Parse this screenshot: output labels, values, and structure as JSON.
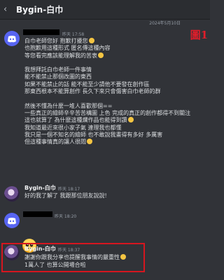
{
  "header": {
    "title": "Bygin-白巾",
    "back_icon": "chevron-left-icon"
  },
  "date_divider": "2024年5月10日",
  "figure_label": "圖1",
  "messages": [
    {
      "author_avatar": "discord-icon",
      "time": "昨天 17:58",
      "lines": [
        "白巾老師您好 抱歉打擾您",
        "也抱歉用這種形式 匿名傳這種內容",
        "等您看完應該能理解我的苦衷",
        "",
        "我想拜託白巾老師一件事情",
        "能不能禁止那個改圖的東西",
        "如果不能禁止的話 能不能至少請他不要發在創作區",
        "那東西根本不能算創作 長久下來只會傷害白巾老師的群",
        "",
        "然後不懂為什麼一堆人喜歡那個==",
        "一些真正的繪師辛辛苦苦構圖 上色 完成的真正的創作都得不到關注",
        "這也就算了 為什麼這種爛作品也能得到讚",
        "我知道最近來很小家子氣 連理我也都懂",
        "我只是一個不知名的繪師 也不敢說我畫得有多好 多厲害",
        "但這種事情真的讓人很悶"
      ]
    },
    {
      "author": "Bygin-白巾",
      "time": "昨天 18:17",
      "text": "好的我了解了 我跟那位朋友說說!"
    },
    {
      "author_avatar": "discord-icon",
      "time": "昨天 18:20",
      "emoji": "pleading-face-emoji"
    },
    {
      "author": "Bygin-白巾",
      "time": "昨天 18:37",
      "lines": [
        "謝謝你跟我分享也提醒我事情的嚴重性",
        "1萬人了 也算公開場合啦"
      ]
    }
  ]
}
